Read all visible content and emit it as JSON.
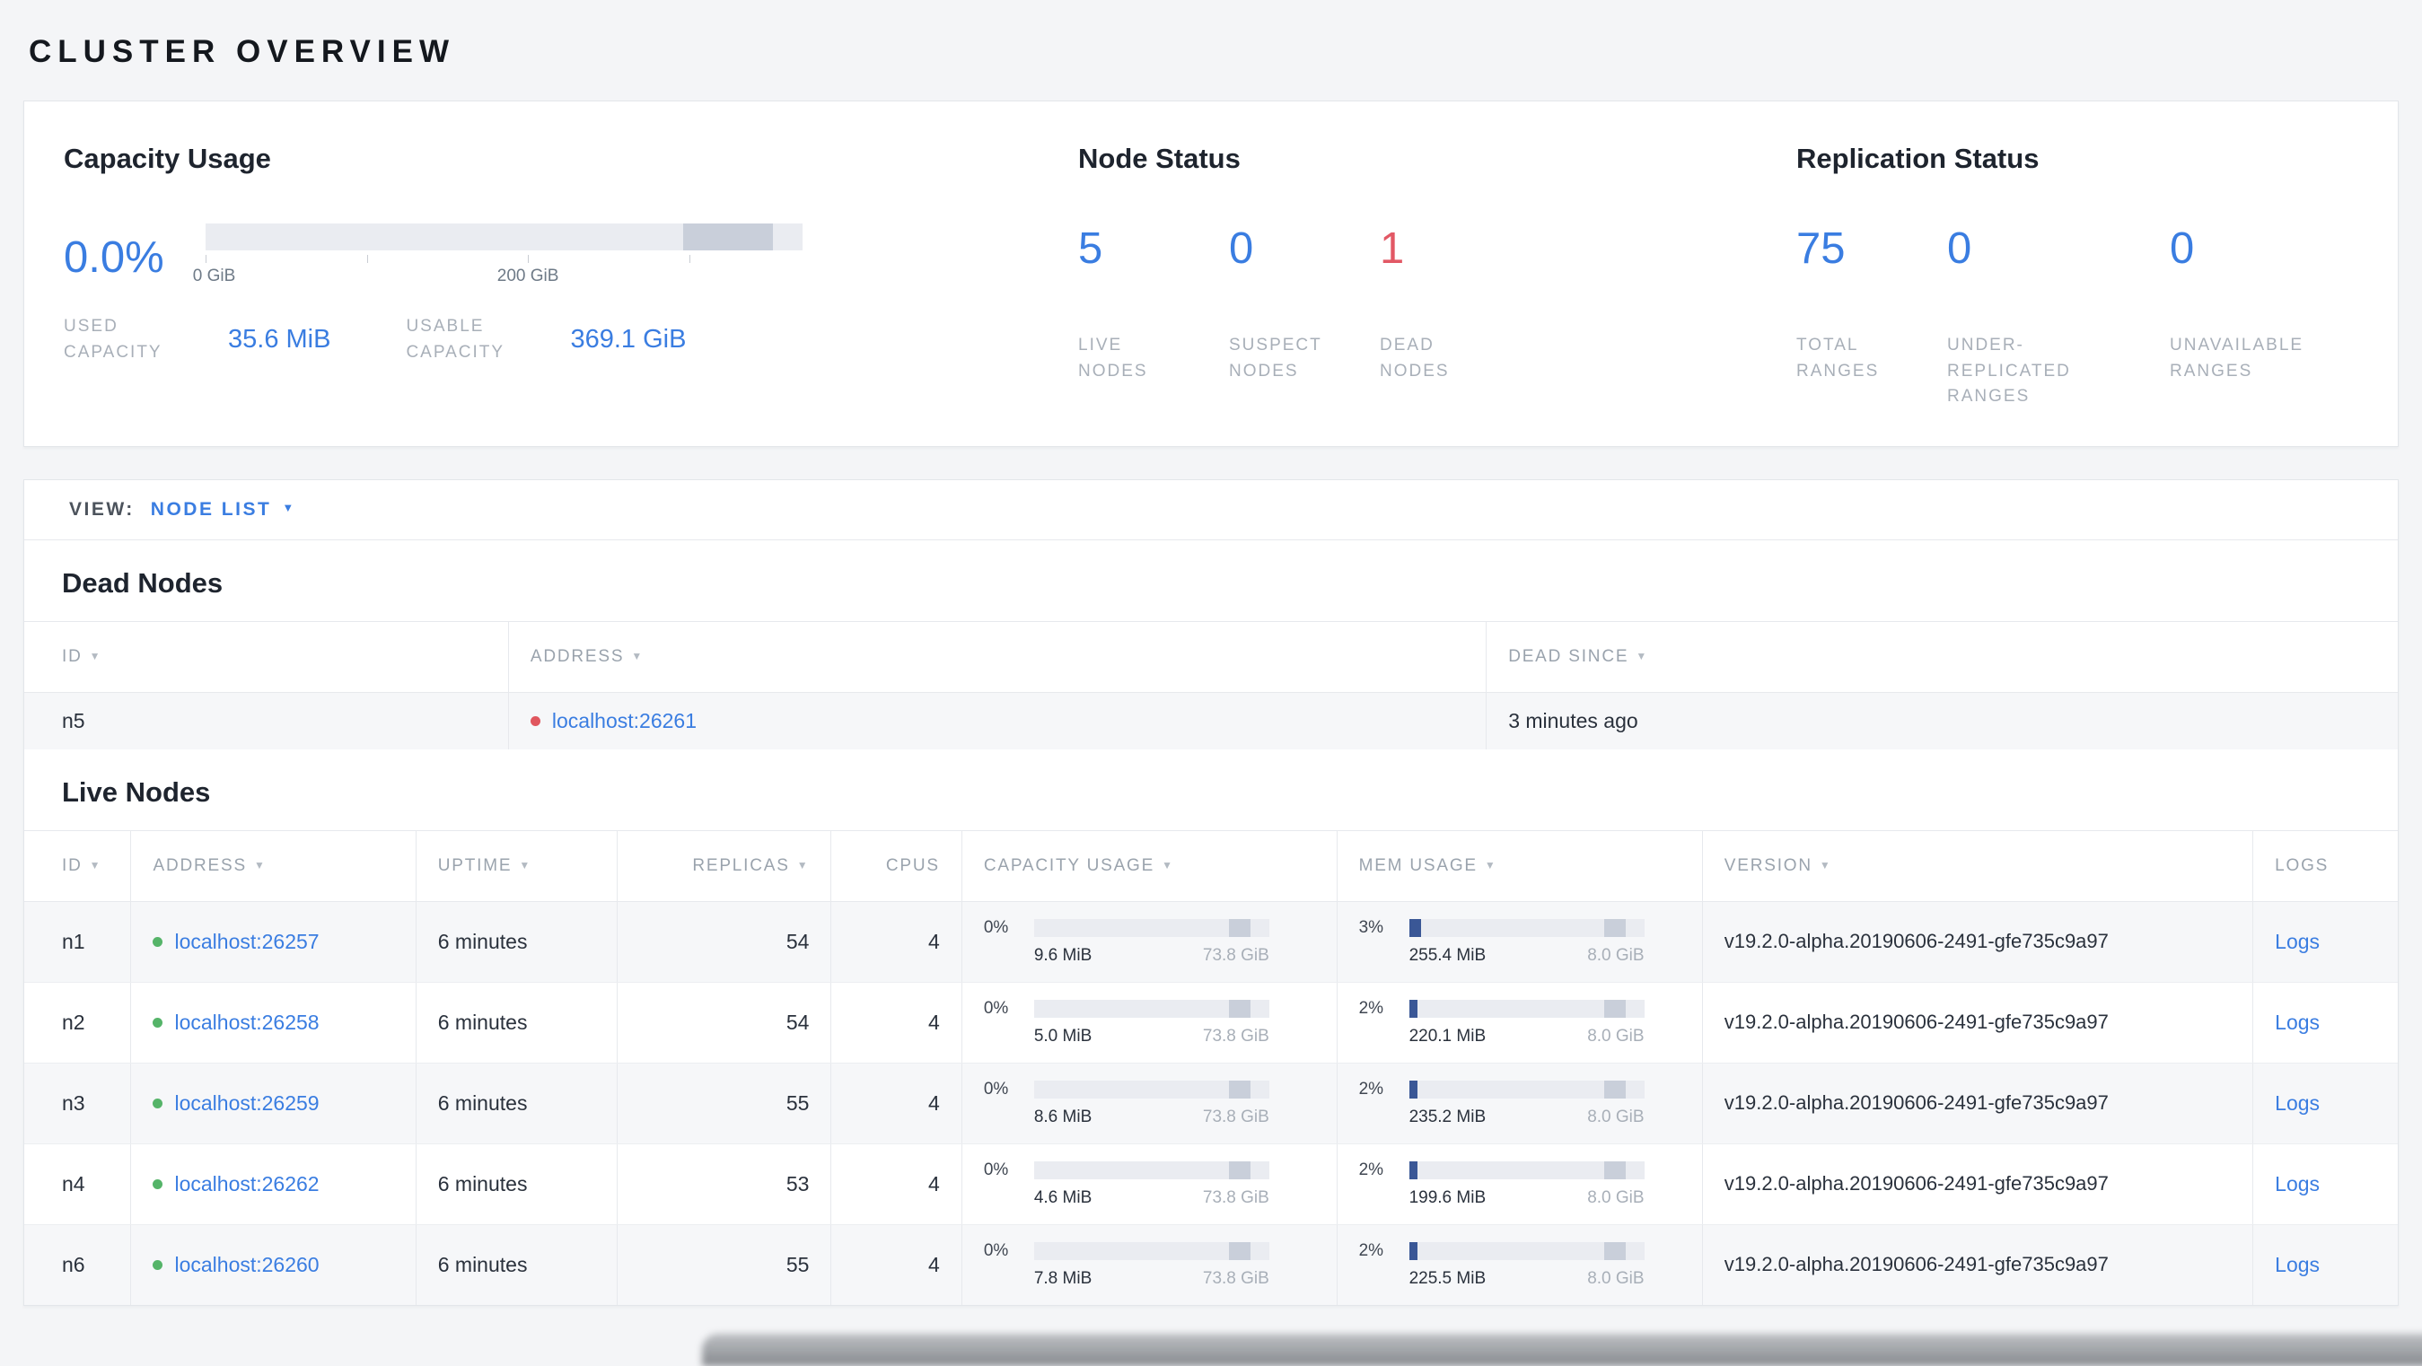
{
  "page": {
    "title": "CLUSTER OVERVIEW"
  },
  "colors": {
    "accent_blue": "#3a7de1",
    "danger_red": "#e25865",
    "healthy_green": "#55b469"
  },
  "summary": {
    "capacity": {
      "title": "Capacity Usage",
      "percent": "0.0%",
      "axis_ticks": [
        "0 GiB",
        "200 GiB"
      ],
      "used": {
        "label": "USED CAPACITY",
        "value": "35.6 MiB"
      },
      "usable": {
        "label": "USABLE CAPACITY",
        "value": "369.1 GiB"
      }
    },
    "node_status": {
      "title": "Node Status",
      "stats": [
        {
          "value": "5",
          "label": "LIVE NODES"
        },
        {
          "value": "0",
          "label": "SUSPECT NODES"
        },
        {
          "value": "1",
          "label": "DEAD NODES"
        }
      ]
    },
    "replication": {
      "title": "Replication Status",
      "stats": [
        {
          "value": "75",
          "label": "TOTAL RANGES"
        },
        {
          "value": "0",
          "label": "UNDER-REPLICATED RANGES"
        },
        {
          "value": "0",
          "label": "UNAVAILABLE RANGES"
        }
      ]
    }
  },
  "view_bar": {
    "label": "VIEW:",
    "selected": "NODE LIST"
  },
  "dead_nodes": {
    "title": "Dead Nodes",
    "columns": [
      "ID",
      "ADDRESS",
      "DEAD SINCE"
    ],
    "rows": [
      {
        "id": "n5",
        "address": "localhost:26261",
        "dead_since": "3 minutes ago"
      }
    ]
  },
  "live_nodes": {
    "title": "Live Nodes",
    "columns": [
      "ID",
      "ADDRESS",
      "UPTIME",
      "REPLICAS",
      "CPUS",
      "CAPACITY USAGE",
      "MEM USAGE",
      "VERSION",
      "LOGS"
    ],
    "rows": [
      {
        "id": "n1",
        "address": "localhost:26257",
        "uptime": "6 minutes",
        "replicas": "54",
        "cpus": "4",
        "capacity": {
          "percent": "0%",
          "used": "9.6 MiB",
          "total": "73.8 GiB"
        },
        "memory": {
          "percent": "3%",
          "used": "255.4 MiB",
          "total": "8.0 GiB"
        },
        "version": "v19.2.0-alpha.20190606-2491-gfe735c9a97",
        "logs_label": "Logs"
      },
      {
        "id": "n2",
        "address": "localhost:26258",
        "uptime": "6 minutes",
        "replicas": "54",
        "cpus": "4",
        "capacity": {
          "percent": "0%",
          "used": "5.0 MiB",
          "total": "73.8 GiB"
        },
        "memory": {
          "percent": "2%",
          "used": "220.1 MiB",
          "total": "8.0 GiB"
        },
        "version": "v19.2.0-alpha.20190606-2491-gfe735c9a97",
        "logs_label": "Logs"
      },
      {
        "id": "n3",
        "address": "localhost:26259",
        "uptime": "6 minutes",
        "replicas": "55",
        "cpus": "4",
        "capacity": {
          "percent": "0%",
          "used": "8.6 MiB",
          "total": "73.8 GiB"
        },
        "memory": {
          "percent": "2%",
          "used": "235.2 MiB",
          "total": "8.0 GiB"
        },
        "version": "v19.2.0-alpha.20190606-2491-gfe735c9a97",
        "logs_label": "Logs"
      },
      {
        "id": "n4",
        "address": "localhost:26262",
        "uptime": "6 minutes",
        "replicas": "53",
        "cpus": "4",
        "capacity": {
          "percent": "0%",
          "used": "4.6 MiB",
          "total": "73.8 GiB"
        },
        "memory": {
          "percent": "2%",
          "used": "199.6 MiB",
          "total": "8.0 GiB"
        },
        "version": "v19.2.0-alpha.20190606-2491-gfe735c9a97",
        "logs_label": "Logs"
      },
      {
        "id": "n6",
        "address": "localhost:26260",
        "uptime": "6 minutes",
        "replicas": "55",
        "cpus": "4",
        "capacity": {
          "percent": "0%",
          "used": "7.8 MiB",
          "total": "73.8 GiB"
        },
        "memory": {
          "percent": "2%",
          "used": "225.5 MiB",
          "total": "8.0 GiB"
        },
        "version": "v19.2.0-alpha.20190606-2491-gfe735c9a97",
        "logs_label": "Logs"
      }
    ]
  }
}
